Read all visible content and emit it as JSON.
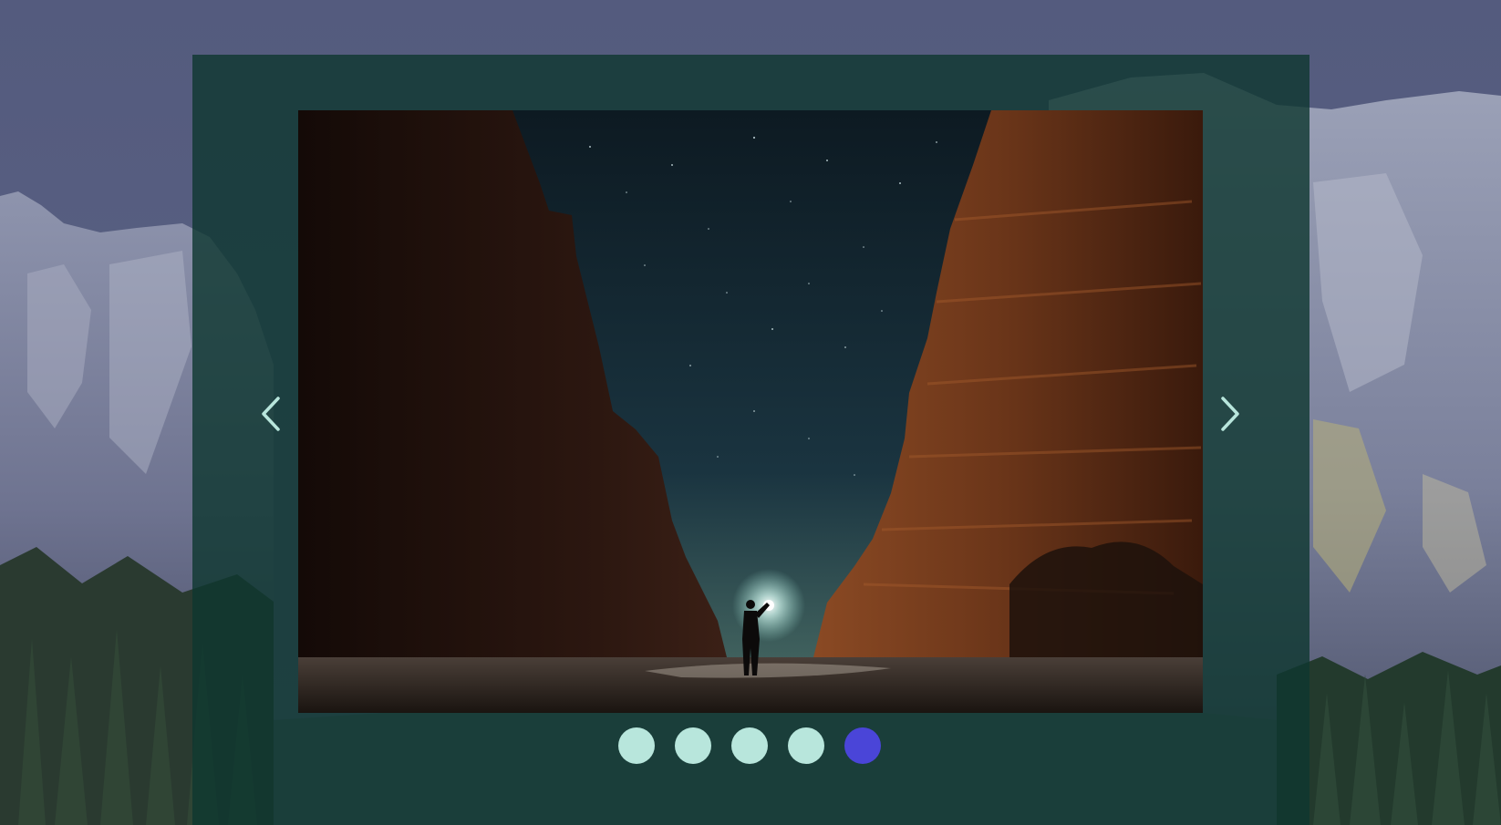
{
  "carousel": {
    "prev_icon": "chevron-left-icon",
    "next_icon": "chevron-right-icon",
    "slide_count": 5,
    "active_slide": 5,
    "colors": {
      "panel": "#0e3730",
      "arrow": "#b8e6dc",
      "dot": "#b8e6dc",
      "dot_active": "#4a45d8",
      "page_background": "#545b7c"
    }
  }
}
